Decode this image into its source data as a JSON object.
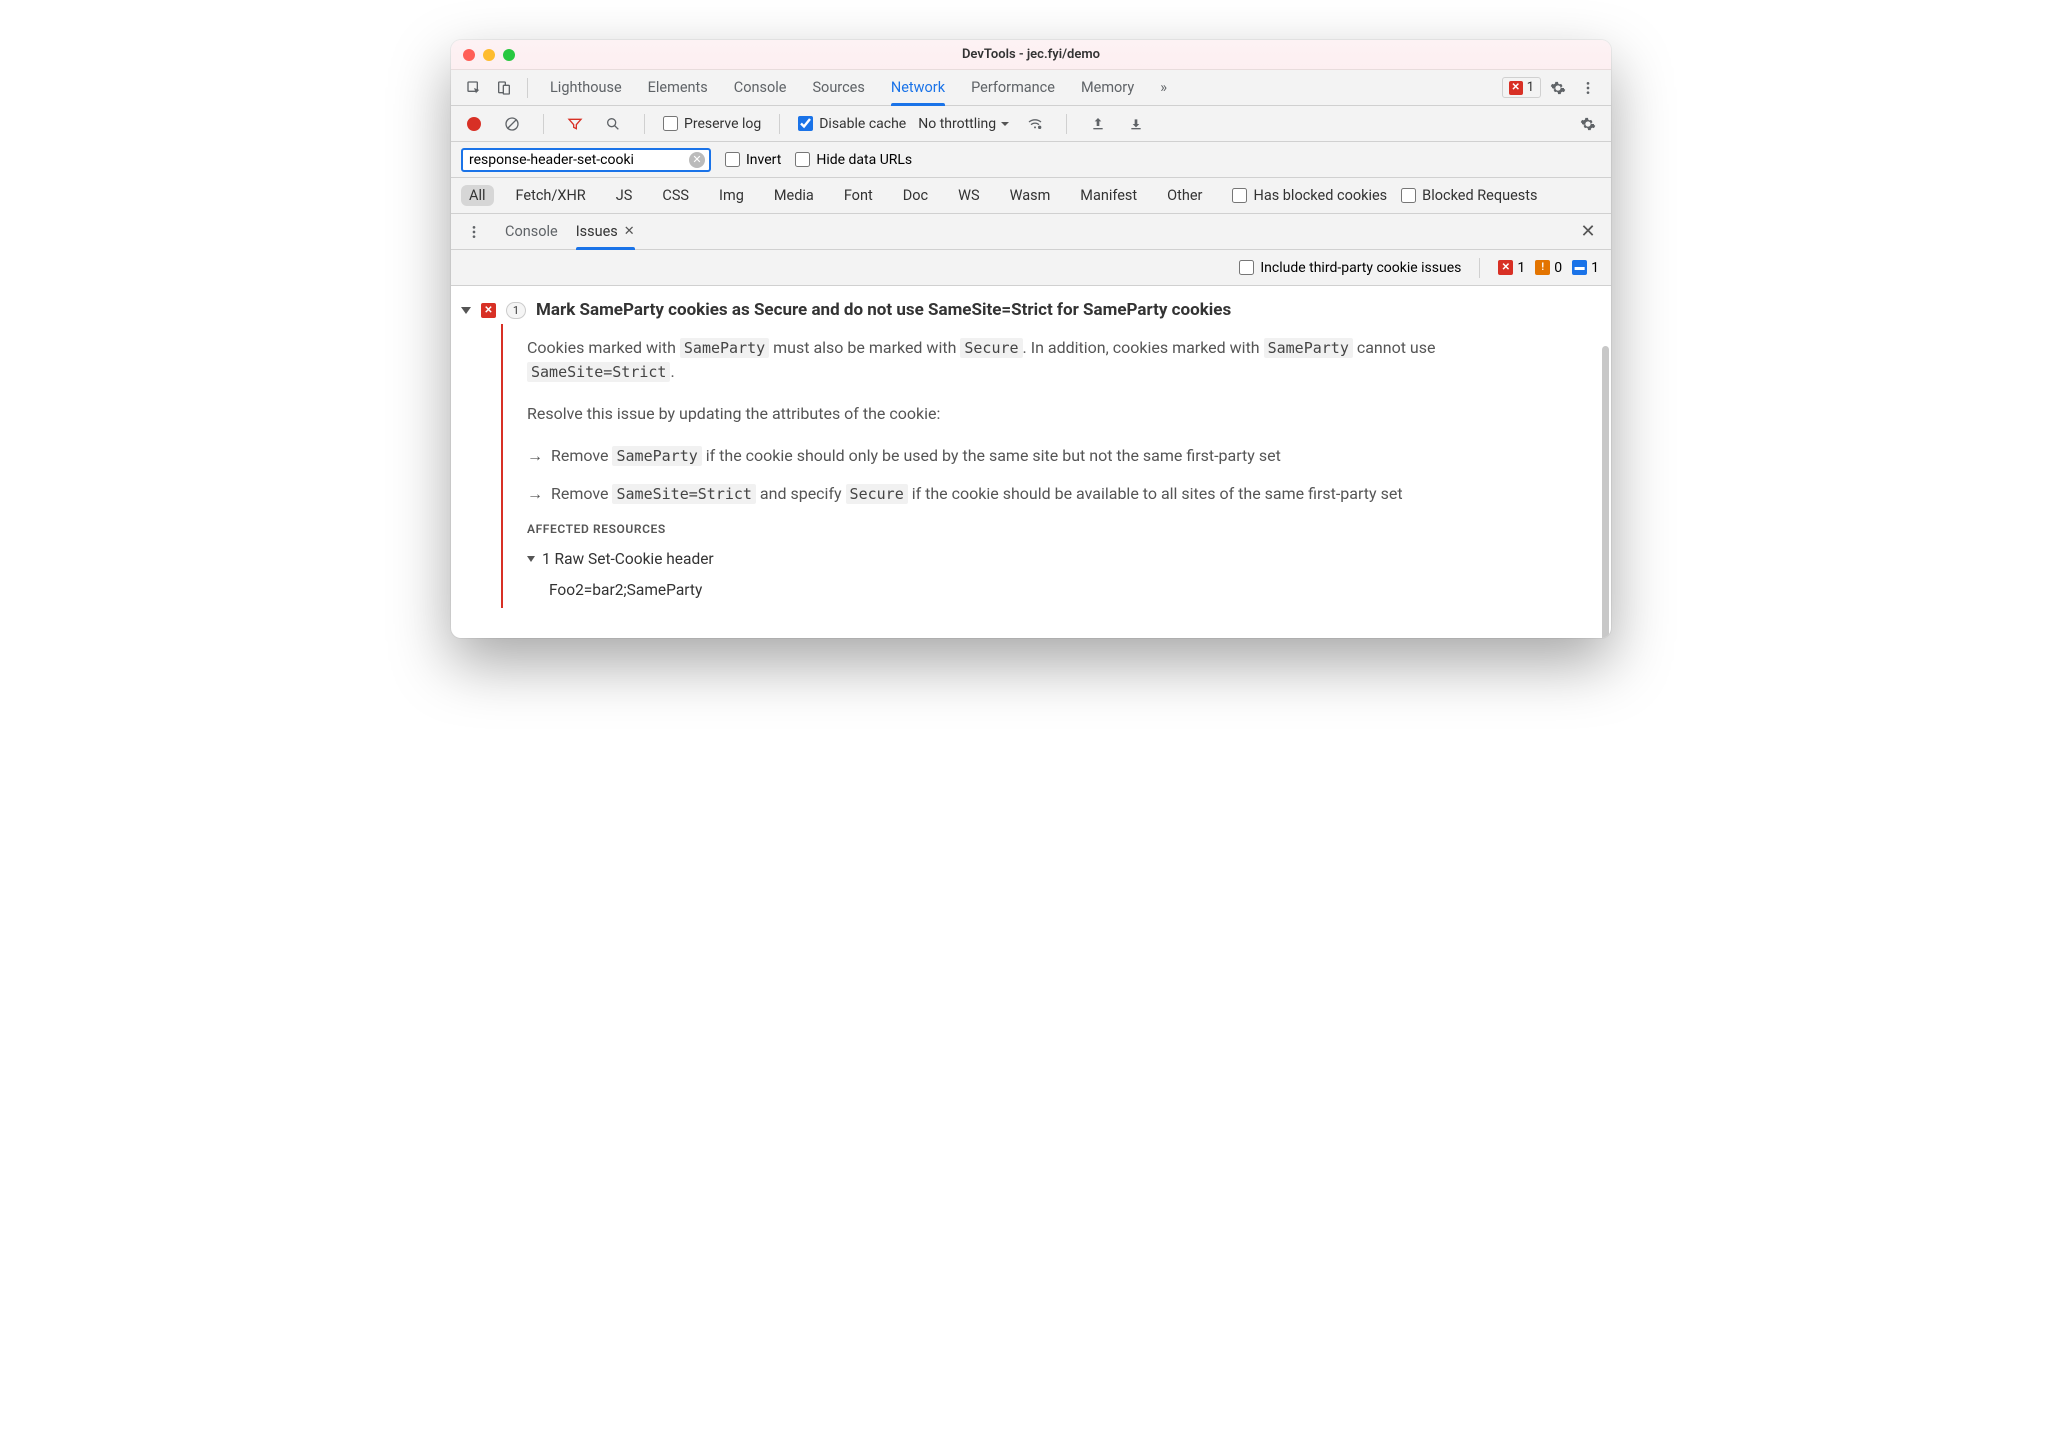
{
  "window": {
    "title": "DevTools - jec.fyi/demo"
  },
  "topTabs": {
    "items": [
      "Lighthouse",
      "Elements",
      "Console",
      "Sources",
      "Network",
      "Performance",
      "Memory"
    ],
    "active": "Network",
    "overflow": "»"
  },
  "errorBadge": {
    "count": "1"
  },
  "netToolbar": {
    "preserveLog": "Preserve log",
    "disableCache": "Disable cache",
    "throttling": "No throttling"
  },
  "filterRow": {
    "filterValue": "response-header-set-cooki",
    "invert": "Invert",
    "hideDataUrls": "Hide data URLs"
  },
  "typeRow": {
    "types": [
      "All",
      "Fetch/XHR",
      "JS",
      "CSS",
      "Img",
      "Media",
      "Font",
      "Doc",
      "WS",
      "Wasm",
      "Manifest",
      "Other"
    ],
    "active": "All",
    "hasBlocked": "Has blocked cookies",
    "blockedReq": "Blocked Requests"
  },
  "drawerTabs": {
    "console": "Console",
    "issues": "Issues"
  },
  "issuesToolbar": {
    "includeThirdParty": "Include third-party cookie issues",
    "counts": {
      "error": "1",
      "warning": "0",
      "info": "1"
    }
  },
  "issue": {
    "count": "1",
    "title": "Mark SameParty cookies as Secure and do not use SameSite=Strict for SameParty cookies",
    "p1a": "Cookies marked with ",
    "p1code1": "SameParty",
    "p1b": " must also be marked with ",
    "p1code2": "Secure",
    "p1c": ". In addition, cookies marked with ",
    "p1code3": "SameParty",
    "p1d": " cannot use ",
    "p1code4": "SameSite=Strict",
    "p1e": ".",
    "p2": "Resolve this issue by updating the attributes of the cookie:",
    "b1a": "Remove ",
    "b1code": "SameParty",
    "b1b": " if the cookie should only be used by the same site but not the same first-party set",
    "b2a": "Remove ",
    "b2code1": "SameSite=Strict",
    "b2b": " and specify ",
    "b2code2": "Secure",
    "b2c": " if the cookie should be available to all sites of the same first-party set",
    "affectedLabel": "AFFECTED RESOURCES",
    "affectedRow": "1 Raw Set-Cookie header",
    "cookieValue": "Foo2=bar2;SameParty"
  }
}
